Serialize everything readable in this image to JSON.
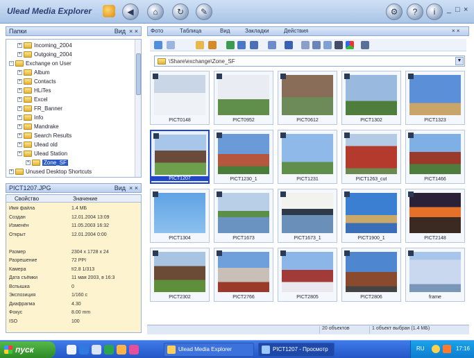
{
  "app": {
    "title": "Ulead Media Explorer",
    "title_buttons": [
      "back-icon",
      "home-icon",
      "refresh-icon",
      "tools-icon"
    ],
    "window_controls": [
      "minimize-icon",
      "maximize-icon",
      "close-icon"
    ]
  },
  "folders_pane": {
    "title": "Папки",
    "view_label": "Вид",
    "items": [
      {
        "label": "Incoming_2004",
        "level": 2,
        "expanded": false
      },
      {
        "label": "Outgoing_2004",
        "level": 2,
        "expanded": false
      },
      {
        "label": "Exchange on User",
        "level": 1,
        "expanded": true
      },
      {
        "label": "Album",
        "level": 2,
        "expanded": false
      },
      {
        "label": "Contacts",
        "level": 2,
        "expanded": false
      },
      {
        "label": "HLiTes",
        "level": 2,
        "expanded": false
      },
      {
        "label": "Excel",
        "level": 2,
        "expanded": false
      },
      {
        "label": "FR_Banner",
        "level": 2,
        "expanded": false
      },
      {
        "label": "Info",
        "level": 2,
        "expanded": false
      },
      {
        "label": "Mandrake",
        "level": 2,
        "expanded": false
      },
      {
        "label": "Search Results",
        "level": 2,
        "expanded": false
      },
      {
        "label": "Ulead old",
        "level": 2,
        "expanded": false
      },
      {
        "label": "Ulead Station",
        "level": 2,
        "expanded": false
      },
      {
        "label": "Zone_SF",
        "level": 3,
        "expanded": false,
        "selected": true
      },
      {
        "label": "Unused Desktop Shortcuts",
        "level": 1,
        "expanded": false
      }
    ]
  },
  "info_pane": {
    "title": "PICT1207.JPG",
    "view_label": "Вид",
    "columns": [
      "Свойство",
      "Значение"
    ],
    "rows": [
      {
        "k": "Имя файла",
        "v": "1.4 МБ"
      },
      {
        "k": "Создан",
        "v": "12.01.2004 13:09"
      },
      {
        "k": "Изменён",
        "v": "11.05.2003 16:32"
      },
      {
        "k": "Открыт",
        "v": "12.01.2004 0:00"
      },
      {
        "k": "",
        "v": ""
      },
      {
        "k": "Размер",
        "v": "2304 x 1728 x 24"
      },
      {
        "k": "Разрешение",
        "v": "72 PPI"
      },
      {
        "k": "Камера",
        "v": "f/2.8 1/313"
      },
      {
        "k": "Дата съёмки",
        "v": "11 мая 2003, в 16:3"
      },
      {
        "k": "Вспышка",
        "v": "0"
      },
      {
        "k": "Экспозиция",
        "v": "1/160 с"
      },
      {
        "k": "Диафрагма",
        "v": "4.30"
      },
      {
        "k": "Фокус",
        "v": "8.00 mm"
      },
      {
        "k": "ISO",
        "v": "100"
      }
    ]
  },
  "tabs": [
    "Фото",
    "Таблица",
    "Вид",
    "Закладки",
    "Действия"
  ],
  "address": {
    "path": "\\Share\\exchange\\Zone_SF"
  },
  "thumbnails": [
    {
      "caption": "PICT0148",
      "scene": "snow"
    },
    {
      "caption": "PICT0952",
      "scene": "church"
    },
    {
      "caption": "PICT0612",
      "scene": "ruin"
    },
    {
      "caption": "PICT1302",
      "scene": "tower"
    },
    {
      "caption": "PICT1323",
      "scene": "tree"
    },
    {
      "caption": "PICT1207",
      "scene": "house",
      "selected": true
    },
    {
      "caption": "PICT1230_1",
      "scene": "castle"
    },
    {
      "caption": "PICT1231",
      "scene": "tree2"
    },
    {
      "caption": "PICT1263_cut",
      "scene": "redtower"
    },
    {
      "caption": "PICT1466",
      "scene": "redcastle"
    },
    {
      "caption": "PICT1304",
      "scene": "parachute"
    },
    {
      "caption": "PICT1673",
      "scene": "lake"
    },
    {
      "caption": "PICT1673_1",
      "scene": "lake2"
    },
    {
      "caption": "PICT1900_1",
      "scene": "coast"
    },
    {
      "caption": "PICT2148",
      "scene": "sunset"
    },
    {
      "caption": "PICT2302",
      "scene": "barn"
    },
    {
      "caption": "PICT2766",
      "scene": "town"
    },
    {
      "caption": "PICT2805",
      "scene": "dome"
    },
    {
      "caption": "PICT2806",
      "scene": "spire"
    },
    {
      "caption": "frame",
      "scene": "building"
    }
  ],
  "status": {
    "count": "20 объектов",
    "selection": "1 объект выбран (1.4 МБ)"
  },
  "taskbar": {
    "start_label": "пуск",
    "tasks": [
      {
        "label": "Ulead Media Explorer",
        "active": false
      },
      {
        "label": "PICT1207 - Просмотр",
        "active": true
      }
    ],
    "time": "17:16",
    "lang": "RU"
  },
  "colors": {
    "accent": "#2147c6",
    "taskbar": "#2456c8",
    "start": "#3c9a33",
    "info_bg": "#fdf3cf"
  }
}
